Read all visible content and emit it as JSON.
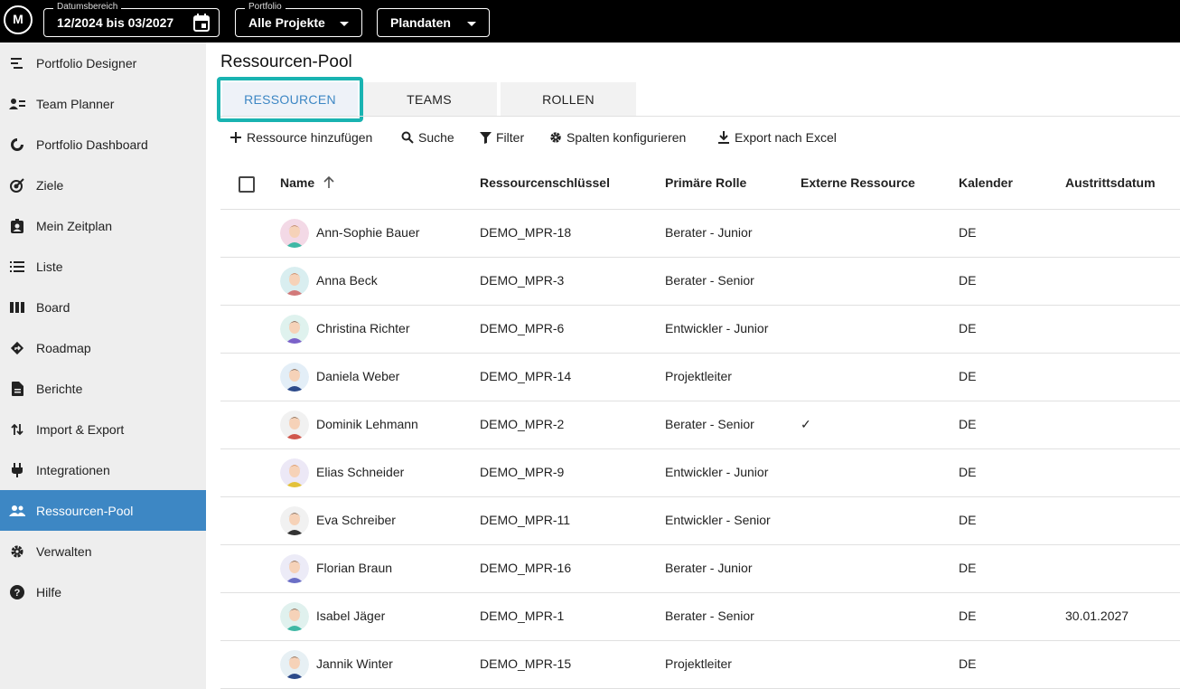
{
  "topbar": {
    "logo_text": "M",
    "date_range": {
      "label": "Datumsbereich",
      "value": "12/2024 bis 03/2027"
    },
    "portfolio": {
      "label": "Portfolio",
      "value": "Alle Projekte"
    },
    "data_select": {
      "value": "Plandaten"
    }
  },
  "sidebar": {
    "items": [
      {
        "label": "Portfolio Designer",
        "icon": "portfolio-designer-icon"
      },
      {
        "label": "Team Planner",
        "icon": "team-planner-icon"
      },
      {
        "label": "Portfolio Dashboard",
        "icon": "dashboard-icon"
      },
      {
        "label": "Ziele",
        "icon": "target-icon"
      },
      {
        "label": "Mein Zeitplan",
        "icon": "badge-icon"
      },
      {
        "label": "Liste",
        "icon": "list-icon"
      },
      {
        "label": "Board",
        "icon": "board-icon"
      },
      {
        "label": "Roadmap",
        "icon": "roadmap-icon"
      },
      {
        "label": "Berichte",
        "icon": "report-icon"
      },
      {
        "label": "Import & Export",
        "icon": "import-export-icon"
      },
      {
        "label": "Integrationen",
        "icon": "plug-icon"
      },
      {
        "label": "Ressourcen-Pool",
        "icon": "people-icon",
        "active": true
      },
      {
        "label": "Verwalten",
        "icon": "gear-icon"
      },
      {
        "label": "Hilfe",
        "icon": "help-icon"
      }
    ]
  },
  "page": {
    "title": "Ressourcen-Pool",
    "tabs": [
      "RESSOURCEN",
      "TEAMS",
      "ROLLEN"
    ],
    "active_tab": "RESSOURCEN"
  },
  "toolbar": {
    "add": "Ressource hinzufügen",
    "search": "Suche",
    "filter": "Filter",
    "columns": "Spalten konfigurieren",
    "export": "Export nach Excel"
  },
  "table": {
    "headers": {
      "name": "Name",
      "key": "Ressourcenschlüssel",
      "role": "Primäre Rolle",
      "external": "Externe Ressource",
      "calendar": "Kalender",
      "exit": "Austrittsdatum"
    },
    "rows": [
      {
        "name": "Ann-Sophie Bauer",
        "key": "DEMO_MPR-18",
        "role": "Berater - Junior",
        "external": "",
        "calendar": "DE",
        "exit": ""
      },
      {
        "name": "Anna Beck",
        "key": "DEMO_MPR-3",
        "role": "Berater - Senior",
        "external": "",
        "calendar": "DE",
        "exit": ""
      },
      {
        "name": "Christina Richter",
        "key": "DEMO_MPR-6",
        "role": "Entwickler - Junior",
        "external": "",
        "calendar": "DE",
        "exit": ""
      },
      {
        "name": "Daniela Weber",
        "key": "DEMO_MPR-14",
        "role": "Projektleiter",
        "external": "",
        "calendar": "DE",
        "exit": ""
      },
      {
        "name": "Dominik Lehmann",
        "key": "DEMO_MPR-2",
        "role": "Berater - Senior",
        "external": "✓",
        "calendar": "DE",
        "exit": ""
      },
      {
        "name": "Elias Schneider",
        "key": "DEMO_MPR-9",
        "role": "Entwickler - Junior",
        "external": "",
        "calendar": "DE",
        "exit": ""
      },
      {
        "name": "Eva Schreiber",
        "key": "DEMO_MPR-11",
        "role": "Entwickler - Senior",
        "external": "",
        "calendar": "DE",
        "exit": ""
      },
      {
        "name": "Florian Braun",
        "key": "DEMO_MPR-16",
        "role": "Berater - Junior",
        "external": "",
        "calendar": "DE",
        "exit": ""
      },
      {
        "name": "Isabel Jäger",
        "key": "DEMO_MPR-1",
        "role": "Berater - Senior",
        "external": "",
        "calendar": "DE",
        "exit": "30.01.2027"
      },
      {
        "name": "Jannik Winter",
        "key": "DEMO_MPR-15",
        "role": "Projektleiter",
        "external": "",
        "calendar": "DE",
        "exit": ""
      }
    ]
  },
  "colors": {
    "accent": "#3d87c4",
    "highlight": "#19b3b1",
    "topbar": "#000000",
    "sidebar": "#eeeeee"
  }
}
